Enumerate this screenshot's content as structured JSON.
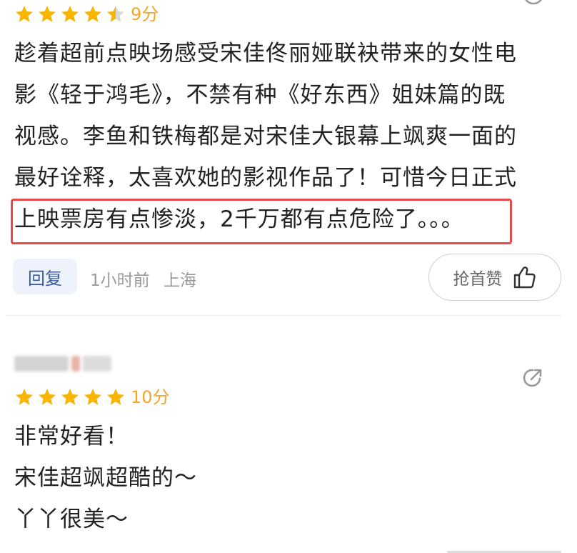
{
  "colors": {
    "star": "#f7b500",
    "accent_blue": "#3a5aa0",
    "highlight": "#e84a4a",
    "meta": "#9a9a9a"
  },
  "review1": {
    "rating_stars": 4.5,
    "score": "9分",
    "lines": [
      "趁着超前点映场感受宋佳佟丽娅联袂带来的女性电",
      "影《轻于鸿毛》，不禁有种《好东西》姐妹篇的既",
      "视感。李鱼和铁梅都是对宋佳大银幕上飒爽一面的",
      "最好诠释，太喜欢她的影视作品了！可惜今日正式",
      "上映票房有点惨淡，2千万都有点危险了。。。"
    ],
    "reply_label": "回复",
    "time": "1小时前",
    "location": "上海",
    "like_label": "抢首赞"
  },
  "review2": {
    "rating_stars": 5,
    "score": "10分",
    "lines": [
      "非常好看！",
      "宋佳超飒超酷的～",
      "丫丫很美～"
    ]
  }
}
